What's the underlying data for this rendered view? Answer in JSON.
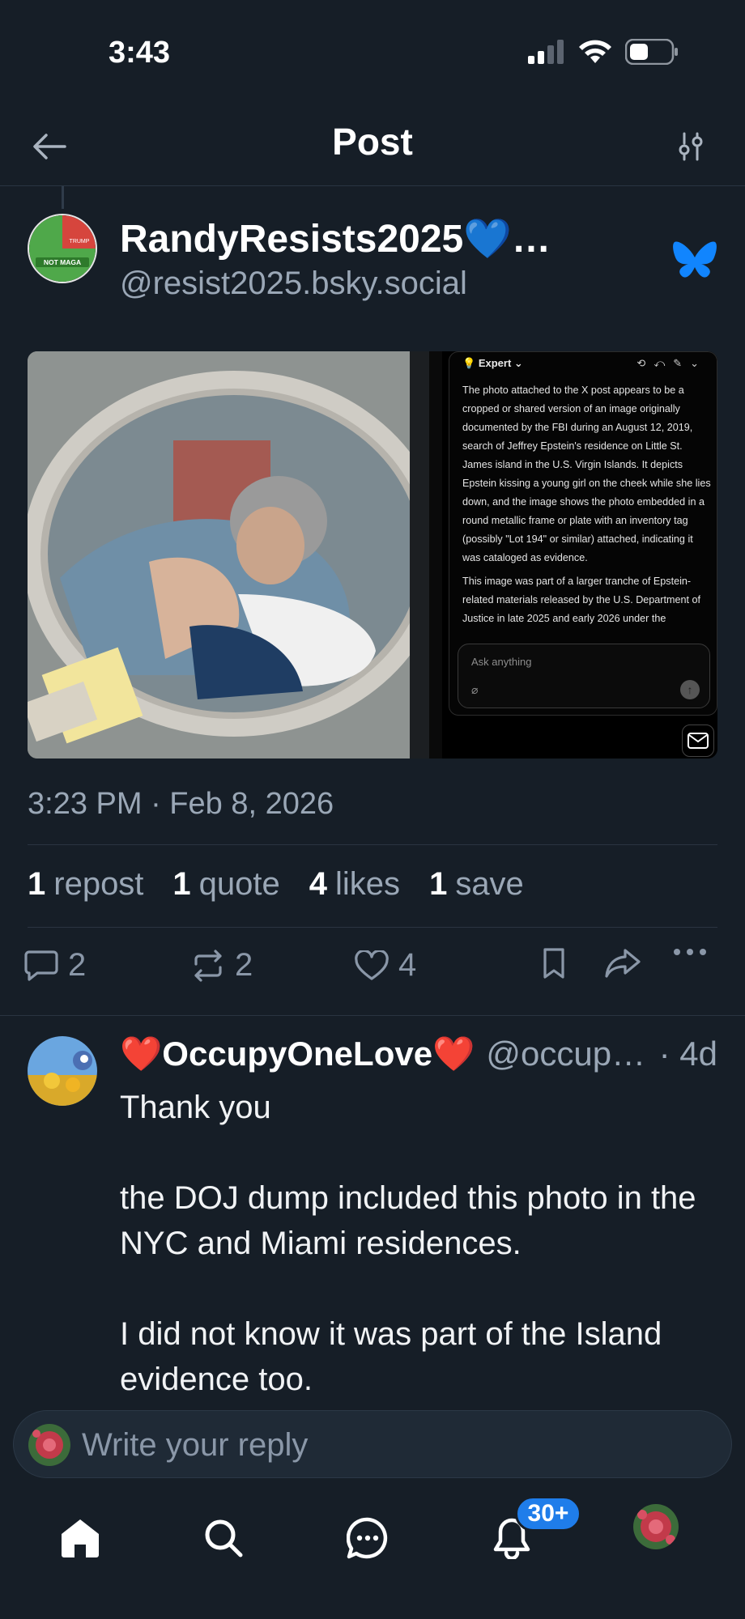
{
  "status_bar": {
    "time": "3:43"
  },
  "header": {
    "title": "Post"
  },
  "post": {
    "author_name": "RandyResists2025💙…",
    "author_handle": "@resist2025.bsky.social",
    "avatar_text": {
      "top": "TRUMP",
      "bottom": "NOT MAGA"
    },
    "timestamp": "3:23 PM · Feb 8, 2026",
    "image": {
      "expert_label": "Expert",
      "expert_paragraph_1": "The photo attached to the X post appears to be a cropped or shared version of an image originally documented by the FBI during an August 12, 2019, search of Jeffrey Epstein's residence on Little St. James island in the U.S. Virgin Islands. It depicts Epstein kissing a young girl on the cheek while she lies down, and the image shows the photo embedded in a round metallic frame or plate with an inventory tag (possibly \"Lot 194\" or similar) attached, indicating it was cataloged as evidence.",
      "expert_paragraph_2": "This image was part of a larger tranche of Epstein-related materials released by the U.S. Department of Justice in late 2025 and early 2026 under the",
      "ask_placeholder": "Ask anything"
    },
    "stats": {
      "reposts_count": "1",
      "reposts_label": "repost",
      "quotes_count": "1",
      "quotes_label": "quote",
      "likes_count": "4",
      "likes_label": "likes",
      "saves_count": "1",
      "saves_label": "save"
    },
    "actions": {
      "reply_count": "2",
      "repost_count": "2",
      "like_count": "4"
    }
  },
  "reply": {
    "name": "❤️OccupyOneLove❤️",
    "handle": "@occup…",
    "age": "· 4d",
    "paragraphs": [
      "Thank you",
      "the DOJ dump included this photo in the NYC and Miami residences.",
      "I did not know it was part of the Island evidence too."
    ]
  },
  "composer": {
    "placeholder": "Write your reply"
  },
  "tab_bar": {
    "notifications_badge": "30+"
  },
  "colors": {
    "background": "#161e27",
    "accent": "#1f7dea",
    "butterfly": "#1185fe",
    "muted": "#9aa7b6"
  }
}
